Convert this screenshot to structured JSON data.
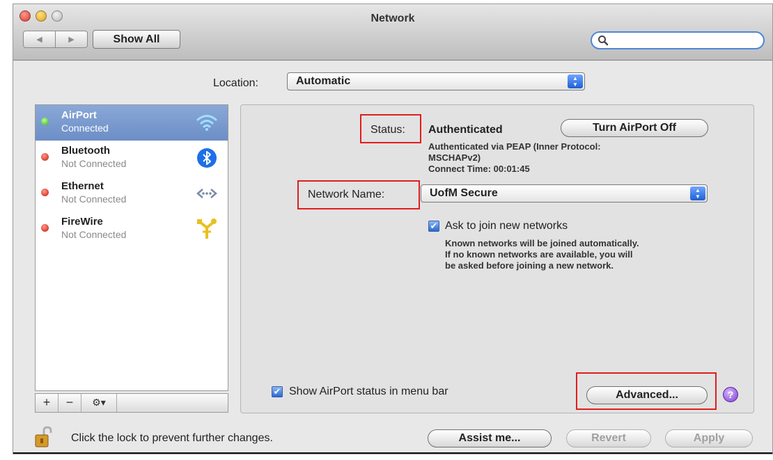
{
  "window": {
    "title": "Network",
    "show_all_label": "Show All",
    "nav_back": "◀",
    "nav_forward": "▶",
    "search_placeholder": ""
  },
  "location": {
    "label": "Location:",
    "value": "Automatic"
  },
  "services": [
    {
      "name": "AirPort",
      "status": "Connected",
      "state": "green",
      "icon": "wifi-icon",
      "selected": true
    },
    {
      "name": "Bluetooth",
      "status": "Not Connected",
      "state": "red",
      "icon": "bluetooth-icon",
      "selected": false
    },
    {
      "name": "Ethernet",
      "status": "Not Connected",
      "state": "red",
      "icon": "ethernet-icon",
      "selected": false
    },
    {
      "name": "FireWire",
      "status": "Not Connected",
      "state": "red",
      "icon": "firewire-icon",
      "selected": false
    }
  ],
  "sidebar_toolbar": {
    "add": "+",
    "remove": "−",
    "actions": "⚙▾"
  },
  "detail": {
    "status_label": "Status:",
    "status_value": "Authenticated",
    "turn_off_label": "Turn AirPort Off",
    "status_info_1": "Authenticated via PEAP (Inner Protocol:",
    "status_info_2": "MSCHAPv2)",
    "status_info_3": "Connect Time: 00:01:45",
    "network_name_label": "Network Name:",
    "network_name_value": "UofM Secure",
    "ask_to_join_label": "Ask to join new networks",
    "ask_to_join_checked": true,
    "ask_info_1": "Known networks will be joined automatically.",
    "ask_info_2": "If no known networks are available, you will",
    "ask_info_3": "be asked before joining a new network.",
    "show_status_label": "Show AirPort status in menu bar",
    "show_status_checked": true,
    "advanced_label": "Advanced...",
    "help_label": "?"
  },
  "footer": {
    "lock_text": "Click the lock to prevent further changes.",
    "assist_label": "Assist me...",
    "revert_label": "Revert",
    "apply_label": "Apply"
  },
  "colors": {
    "highlight_box": "#e11d1d",
    "selection": "#7b9ccf",
    "accent": "#2c67d2"
  }
}
